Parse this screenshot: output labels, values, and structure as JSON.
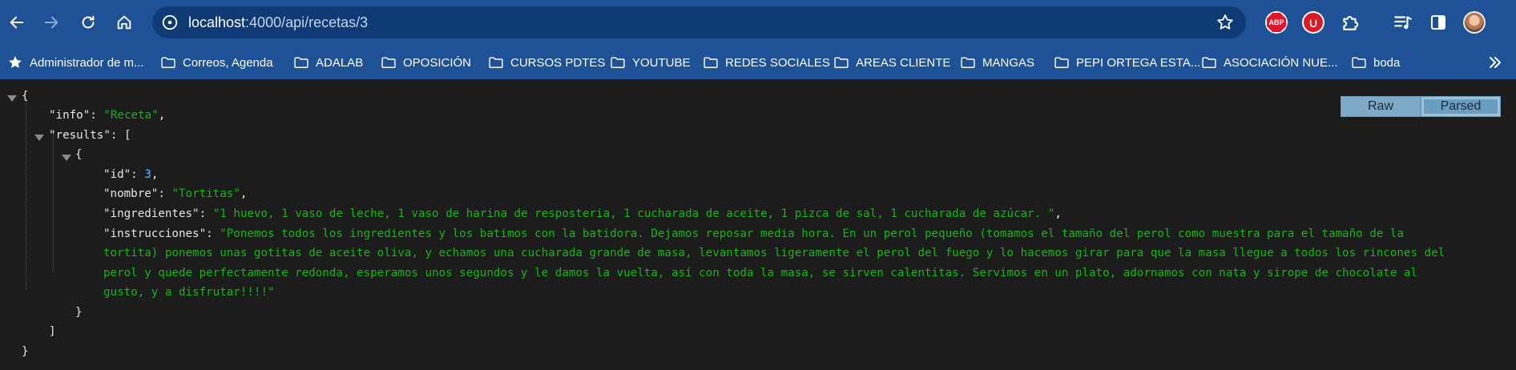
{
  "browser": {
    "url_host": "localhost",
    "url_path": ":4000/api/recetas/3",
    "colors": {
      "chrome": "#1e5196",
      "omnibox": "#0f3a75"
    }
  },
  "nav_icons": [
    "back-icon",
    "forward-icon",
    "reload-icon",
    "home-icon"
  ],
  "extension_icons": [
    "adblock-plus-icon",
    "ublock-icon",
    "puzzle-icon",
    "reading-list-icon",
    "side-panel-icon",
    "profile-avatar"
  ],
  "abp_label": "ABP",
  "bookmarks": [
    {
      "label": "Administrador de m...",
      "icon": "star-icon"
    },
    {
      "label": "Correos, Agenda",
      "icon": "folder-icon"
    },
    {
      "label": "ADALAB",
      "icon": "folder-icon"
    },
    {
      "label": "OPOSICIÓN",
      "icon": "folder-icon"
    },
    {
      "label": "CURSOS PDTES",
      "icon": "folder-icon"
    },
    {
      "label": "YOUTUBE",
      "icon": "folder-icon"
    },
    {
      "label": "REDES SOCIALES",
      "icon": "folder-icon"
    },
    {
      "label": "AREAS CLIENTE",
      "icon": "folder-icon"
    },
    {
      "label": "MANGAS",
      "icon": "folder-icon"
    },
    {
      "label": "PEPI ORTEGA ESTA...",
      "icon": "folder-icon"
    },
    {
      "label": "ASOCIACIÓN NUE...",
      "icon": "folder-icon"
    },
    {
      "label": "boda",
      "icon": "folder-icon"
    }
  ],
  "viewer": {
    "raw_label": "Raw",
    "parsed_label": "Parsed",
    "json": {
      "info": "Receta",
      "id": "3",
      "nombre": "Tortitas",
      "ingredientes": "1 huevo, 1 vaso de leche, 1 vaso de harina de resposteria, 1 cucharada de aceite, 1 pizca de sal, 1 cucharada de azúcar. ",
      "instrucciones_lines": [
        "Ponemos todos los ingredientes y los batimos con la batidora. Dejamos reposar media hora. En un perol pequeño (tomamos el tamaño del perol como muestra para el tamaño de la",
        "tortita) ponemos unas gotitas de aceite oliva, y echamos una cucharada grande de masa, levantamos ligeramente el perol del fuego y lo hacemos girar para que la masa llegue a todos los rincones del",
        "perol y quede perfectamente redonda, esperamos unos segundos y le damos la vuelta, así con toda la masa, se sirven calentitas. Servimos en un plato, adornamos con nata y sirope de chocolate al",
        "gusto, y a disfrutar!!!!"
      ]
    },
    "colors": {
      "string": "#17b517",
      "number": "#52b8ff",
      "key": "#e6e6e6",
      "background": "#1c1c1c"
    }
  }
}
